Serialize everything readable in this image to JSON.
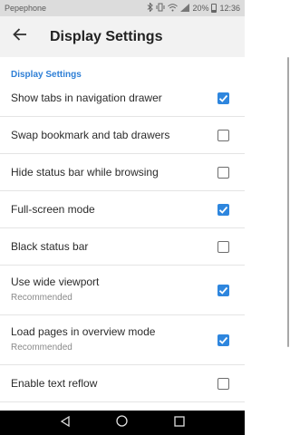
{
  "status_bar": {
    "carrier": "Pepephone",
    "battery_percent": "20%",
    "battery_level": 0.2,
    "time": "12:36",
    "icons": [
      "bluetooth-icon",
      "vibrate-icon",
      "wifi-icon",
      "cell-signal-icon",
      "battery-icon"
    ]
  },
  "app_bar": {
    "title": "Display Settings",
    "back_icon": "arrow-back-icon"
  },
  "section": {
    "header": "Display Settings"
  },
  "settings": [
    {
      "label": "Show tabs in navigation drawer",
      "summary": "",
      "checked": true
    },
    {
      "label": "Swap bookmark and tab drawers",
      "summary": "",
      "checked": false
    },
    {
      "label": "Hide status bar while browsing",
      "summary": "",
      "checked": false
    },
    {
      "label": "Full-screen mode",
      "summary": "",
      "checked": true
    },
    {
      "label": "Black status bar",
      "summary": "",
      "checked": false
    },
    {
      "label": "Use wide viewport",
      "summary": "Recommended",
      "checked": true
    },
    {
      "label": "Load pages in overview mode",
      "summary": "Recommended",
      "checked": true
    },
    {
      "label": "Enable text reflow",
      "summary": "",
      "checked": false
    }
  ],
  "nav_bar": {
    "buttons": [
      "back-triangle-icon",
      "home-circle-icon",
      "recents-square-icon"
    ]
  },
  "colors": {
    "accent": "#2e86de",
    "section_header": "#2e7fd6",
    "status_bar_bg": "#dcdcdc",
    "app_bar_bg": "#f2f2f2"
  }
}
